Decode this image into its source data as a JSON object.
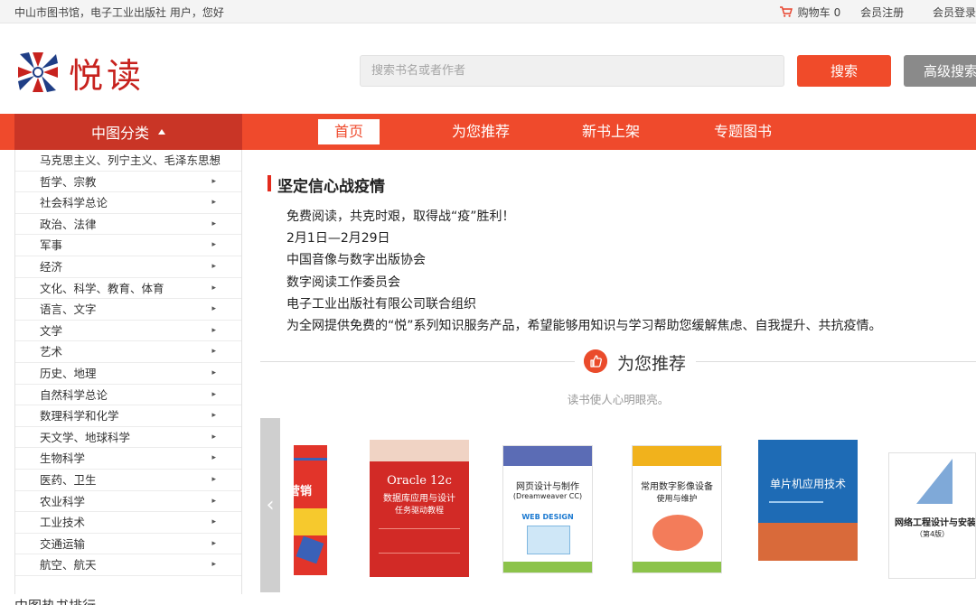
{
  "topbar": {
    "greeting": "中山市图书馆，电子工业出版社 用户，您好",
    "cart_label": "购物车",
    "cart_count": "0",
    "register": "会员注册",
    "member": "会员登录"
  },
  "header": {
    "logo_text": "悦读",
    "search_placeholder": "搜索书名或者作者",
    "search_button": "搜索",
    "advanced_button": "高级搜索"
  },
  "nav": {
    "category_label": "中图分类",
    "items": [
      "首页",
      "为您推荐",
      "新书上架",
      "专题图书"
    ]
  },
  "categories": [
    "马克思主义、列宁主义、毛泽东思想",
    "哲学、宗教",
    "社会科学总论",
    "政治、法律",
    "军事",
    "经济",
    "文化、科学、教育、体育",
    "语言、文字",
    "文学",
    "艺术",
    "历史、地理",
    "自然科学总论",
    "数理科学和化学",
    "天文学、地球科学",
    "生物科学",
    "医药、卫生",
    "农业科学",
    "工业技术",
    "交通运输",
    "航空、航天"
  ],
  "notice": {
    "title": "坚定信心战疫情",
    "lines": [
      "免费阅读，共克时艰，取得战“疫”胜利！",
      "2月1日—2月29日",
      "中国音像与数字出版协会",
      "数字阅读工作委员会",
      "电子工业出版社有限公司联合组织",
      "为全网提供免费的“悦”系列知识服务产品，希望能够用知识与学习帮助您缓解焦虑、自我提升、共抗疫情。"
    ]
  },
  "recommend": {
    "title": "为您推荐",
    "subtitle": "读书使人心明眼亮。"
  },
  "books": [
    {
      "title": "营销"
    },
    {
      "title": "Oracle 12c",
      "subtitle": "数据库应用与设计",
      "subtitle2": "任务驱动教程"
    },
    {
      "title": "网页设计与制作",
      "subtitle": "(Dreamweaver CC)",
      "badge": "WEB DESIGN"
    },
    {
      "title": "常用数字影像设备",
      "subtitle": "使用与维护"
    },
    {
      "title": "单片机应用技术"
    },
    {
      "title": "网络工程设计与安装",
      "subtitle": "（第4版）"
    }
  ],
  "bottom": {
    "text": "中图热书排行"
  },
  "colors": {
    "accent": "#ef4a2c",
    "category_dark": "#c93526",
    "logo_red": "#c7221e",
    "logo_blue": "#1f3e86"
  }
}
